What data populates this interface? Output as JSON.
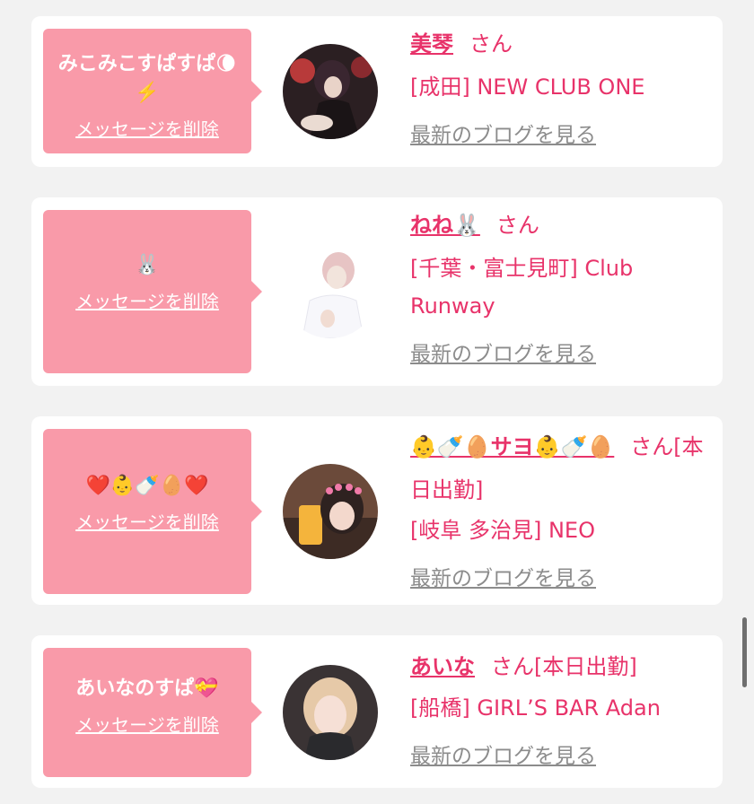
{
  "colors": {
    "background": "#f2f2f2",
    "card": "#ffffff",
    "bubble": "#f99aa9",
    "accent": "#e8336a",
    "link_gray": "#8c8c8c"
  },
  "cards": [
    {
      "message": "みこみこすぱすぱ🌘⚡️",
      "delete_label": "メッセージを削除",
      "name": "美琴",
      "honorific": "さん",
      "extra": "",
      "shop": "[成田] NEW CLUB ONE",
      "blog_link": "最新のブログを見る"
    },
    {
      "message": "🐰",
      "delete_label": "メッセージを削除",
      "name": "ねね🐰",
      "honorific": "さん",
      "extra": "",
      "shop": "[千葉・富士見町] Club Runway",
      "blog_link": "最新のブログを見る"
    },
    {
      "message": "❤️👶🍼🥚❤️",
      "delete_label": "メッセージを削除",
      "name": "👶🍼🥚サヨ👶🍼🥚",
      "honorific": "さん",
      "extra": "[本日出勤]",
      "shop": "[岐阜 多治見] NEO",
      "blog_link": "最新のブログを見る"
    },
    {
      "message": "あいなのすぱ💝",
      "delete_label": "メッセージを削除",
      "name": "あいな",
      "honorific": "さん",
      "extra": "[本日出勤]",
      "shop": "[船橋] GIRL’S BAR Adan",
      "blog_link": "最新のブログを見る"
    }
  ]
}
